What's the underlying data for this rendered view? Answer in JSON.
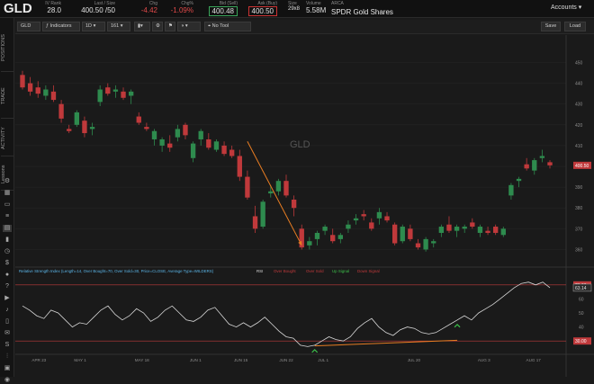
{
  "header": {
    "symbol": "GLD",
    "iv_rank_label": "IV Rank",
    "iv_rank": "28.0",
    "last_size_label": "Last / Size",
    "last_size": "400.50 /50",
    "chg_label": "Chg",
    "chg": "-4.42",
    "chg_pct_label": "Chg%",
    "chg_pct": "-1.09%",
    "bid_label": "Bid (Sell)",
    "bid": "400.48",
    "ask_label": "Ask (Buy)",
    "ask": "400.50",
    "size_label": "Size",
    "size": "29x8",
    "volume_label": "Volume",
    "volume": "5.58M",
    "arca_label": "ARCA",
    "name": "SPDR Gold Shares",
    "accounts": "Accounts"
  },
  "sidebar": {
    "tabs": [
      "POSITIONS",
      "TRADE",
      "ACTIVITY",
      "Lessons"
    ]
  },
  "toolbar": {
    "symbol": "GLD",
    "indicators": "Indicators",
    "interval": "1D",
    "period": "161",
    "drawing": "No Tool",
    "save": "Save",
    "load": "Load"
  },
  "chart": {
    "watermark": "GLD",
    "price_ticks": [
      "450",
      "440",
      "430",
      "420",
      "410",
      "400",
      "390",
      "380",
      "370",
      "360"
    ],
    "current_price": "400.50",
    "date_labels": [
      "APR 23",
      "MAY 1",
      "MAY 18",
      "JUN 1",
      "JUN 15",
      "JUN 22",
      "JUL 1",
      "JUL 20",
      "AUG 3",
      "AUG 17"
    ],
    "rsi_title": "Relative Strength Index (Length=14, Over Bought=70, Over Sold=30, Price=CLOSE, Average Type=WILDERS)",
    "rsi_name": "RSI",
    "rsi_legend": [
      "Over Bought",
      "Over Sold",
      "Up Signal",
      "Down Signal"
    ],
    "rsi_ticks": [
      "70.00",
      "60",
      "50",
      "40",
      "30.00"
    ],
    "rsi_current": "63.14",
    "colors": {
      "up": "#2e8b4e",
      "down": "#c0393b",
      "arrow": "#e87d22",
      "rsi": "#d8d8d8",
      "ob": "#c0393b",
      "os": "#c0393b",
      "signal_up": "#3cbf4a"
    }
  },
  "chart_data": {
    "type": "candlestick",
    "price_range": [
      355,
      458
    ],
    "candles": [
      {
        "o": 444,
        "h": 446,
        "l": 437,
        "c": 438
      },
      {
        "o": 440,
        "h": 443,
        "l": 434,
        "c": 436
      },
      {
        "o": 438,
        "h": 441,
        "l": 433,
        "c": 435
      },
      {
        "o": 434,
        "h": 439,
        "l": 432,
        "c": 437
      },
      {
        "o": 436,
        "h": 439,
        "l": 431,
        "c": 432
      },
      {
        "o": 430,
        "h": 432,
        "l": 421,
        "c": 423
      },
      {
        "o": 418,
        "h": 420,
        "l": 416,
        "c": 417
      },
      {
        "o": 420,
        "h": 427,
        "l": 419,
        "c": 426
      },
      {
        "o": 422,
        "h": 424,
        "l": 414,
        "c": 416
      },
      {
        "o": 418,
        "h": 421,
        "l": 415,
        "c": 419
      },
      {
        "o": 431,
        "h": 439,
        "l": 429,
        "c": 437
      },
      {
        "o": 438,
        "h": 440,
        "l": 434,
        "c": 435
      },
      {
        "o": 436,
        "h": 439,
        "l": 433,
        "c": 437
      },
      {
        "o": 436,
        "h": 438,
        "l": 432,
        "c": 433
      },
      {
        "o": 434,
        "h": 437,
        "l": 430,
        "c": 436
      },
      {
        "o": 424,
        "h": 426,
        "l": 420,
        "c": 421
      },
      {
        "o": 419,
        "h": 421,
        "l": 417,
        "c": 418
      },
      {
        "o": 413,
        "h": 418,
        "l": 410,
        "c": 417
      },
      {
        "o": 410,
        "h": 414,
        "l": 407,
        "c": 413
      },
      {
        "o": 411,
        "h": 415,
        "l": 407,
        "c": 409
      },
      {
        "o": 414,
        "h": 420,
        "l": 412,
        "c": 418
      },
      {
        "o": 420,
        "h": 421,
        "l": 413,
        "c": 415
      },
      {
        "o": 404,
        "h": 412,
        "l": 402,
        "c": 411
      },
      {
        "o": 413,
        "h": 418,
        "l": 410,
        "c": 417
      },
      {
        "o": 413,
        "h": 416,
        "l": 408,
        "c": 409
      },
      {
        "o": 408,
        "h": 413,
        "l": 407,
        "c": 412
      },
      {
        "o": 410,
        "h": 412,
        "l": 405,
        "c": 406
      },
      {
        "o": 408,
        "h": 410,
        "l": 404,
        "c": 405
      },
      {
        "o": 405,
        "h": 408,
        "l": 393,
        "c": 395
      },
      {
        "o": 395,
        "h": 398,
        "l": 384,
        "c": 385
      },
      {
        "o": 376,
        "h": 381,
        "l": 368,
        "c": 370
      },
      {
        "o": 371,
        "h": 384,
        "l": 370,
        "c": 383
      },
      {
        "o": 387,
        "h": 391,
        "l": 385,
        "c": 388
      },
      {
        "o": 388,
        "h": 394,
        "l": 386,
        "c": 393
      },
      {
        "o": 393,
        "h": 396,
        "l": 385,
        "c": 386
      },
      {
        "o": 384,
        "h": 386,
        "l": 376,
        "c": 380
      },
      {
        "o": 370,
        "h": 372,
        "l": 360,
        "c": 361
      },
      {
        "o": 362,
        "h": 366,
        "l": 360,
        "c": 364
      },
      {
        "o": 365,
        "h": 369,
        "l": 362,
        "c": 368
      },
      {
        "o": 369,
        "h": 372,
        "l": 367,
        "c": 371
      },
      {
        "o": 367,
        "h": 370,
        "l": 363,
        "c": 364
      },
      {
        "o": 365,
        "h": 368,
        "l": 363,
        "c": 367
      },
      {
        "o": 370,
        "h": 374,
        "l": 368,
        "c": 372
      },
      {
        "o": 374,
        "h": 377,
        "l": 372,
        "c": 375
      },
      {
        "o": 377,
        "h": 379,
        "l": 374,
        "c": 376
      },
      {
        "o": 373,
        "h": 375,
        "l": 369,
        "c": 370
      },
      {
        "o": 375,
        "h": 380,
        "l": 372,
        "c": 378
      },
      {
        "o": 376,
        "h": 378,
        "l": 373,
        "c": 374
      },
      {
        "o": 372,
        "h": 373,
        "l": 362,
        "c": 363
      },
      {
        "o": 364,
        "h": 372,
        "l": 363,
        "c": 371
      },
      {
        "o": 370,
        "h": 372,
        "l": 364,
        "c": 365
      },
      {
        "o": 363,
        "h": 365,
        "l": 360,
        "c": 361
      },
      {
        "o": 360,
        "h": 366,
        "l": 359,
        "c": 365
      },
      {
        "o": 363,
        "h": 365,
        "l": 361,
        "c": 364
      },
      {
        "o": 368,
        "h": 372,
        "l": 366,
        "c": 371
      },
      {
        "o": 372,
        "h": 376,
        "l": 368,
        "c": 369
      },
      {
        "o": 369,
        "h": 372,
        "l": 366,
        "c": 371
      },
      {
        "o": 370,
        "h": 372,
        "l": 368,
        "c": 371
      },
      {
        "o": 373,
        "h": 375,
        "l": 370,
        "c": 371
      },
      {
        "o": 368,
        "h": 372,
        "l": 366,
        "c": 371
      },
      {
        "o": 369,
        "h": 371,
        "l": 367,
        "c": 368
      },
      {
        "o": 371,
        "h": 372,
        "l": 367,
        "c": 368
      },
      {
        "o": 367,
        "h": 371,
        "l": 366,
        "c": 370
      },
      {
        "o": 386,
        "h": 392,
        "l": 384,
        "c": 391
      },
      {
        "o": 393,
        "h": 395,
        "l": 390,
        "c": 394
      },
      {
        "o": 401,
        "h": 404,
        "l": 398,
        "c": 399
      },
      {
        "o": 398,
        "h": 404,
        "l": 396,
        "c": 403
      },
      {
        "o": 404,
        "h": 408,
        "l": 402,
        "c": 405
      },
      {
        "o": 402,
        "h": 403,
        "l": 399,
        "c": 400.5
      }
    ],
    "rsi_range": [
      25,
      75
    ],
    "overbought": 70,
    "oversold": 30,
    "rsi": [
      55,
      52,
      48,
      46,
      52,
      50,
      45,
      40,
      43,
      42,
      47,
      52,
      55,
      49,
      45,
      48,
      53,
      50,
      44,
      47,
      52,
      55,
      50,
      45,
      44,
      47,
      52,
      54,
      48,
      42,
      40,
      43,
      40,
      43,
      47,
      42,
      37,
      33,
      32,
      27,
      26,
      27,
      30,
      33,
      31,
      30,
      33,
      39,
      43,
      46,
      40,
      36,
      34,
      38,
      40,
      39,
      36,
      35,
      36,
      39,
      42,
      45,
      48,
      45,
      50,
      53,
      56,
      60,
      64,
      68,
      71,
      72,
      70,
      72,
      68
    ],
    "up_signals": [
      41,
      61
    ],
    "annotation_arrow": {
      "from": [
        29,
        412
      ],
      "to": [
        36,
        362
      ]
    },
    "rsi_divergence_line": {
      "from": [
        41,
        26.5
      ],
      "to": [
        61,
        30.5
      ]
    }
  }
}
